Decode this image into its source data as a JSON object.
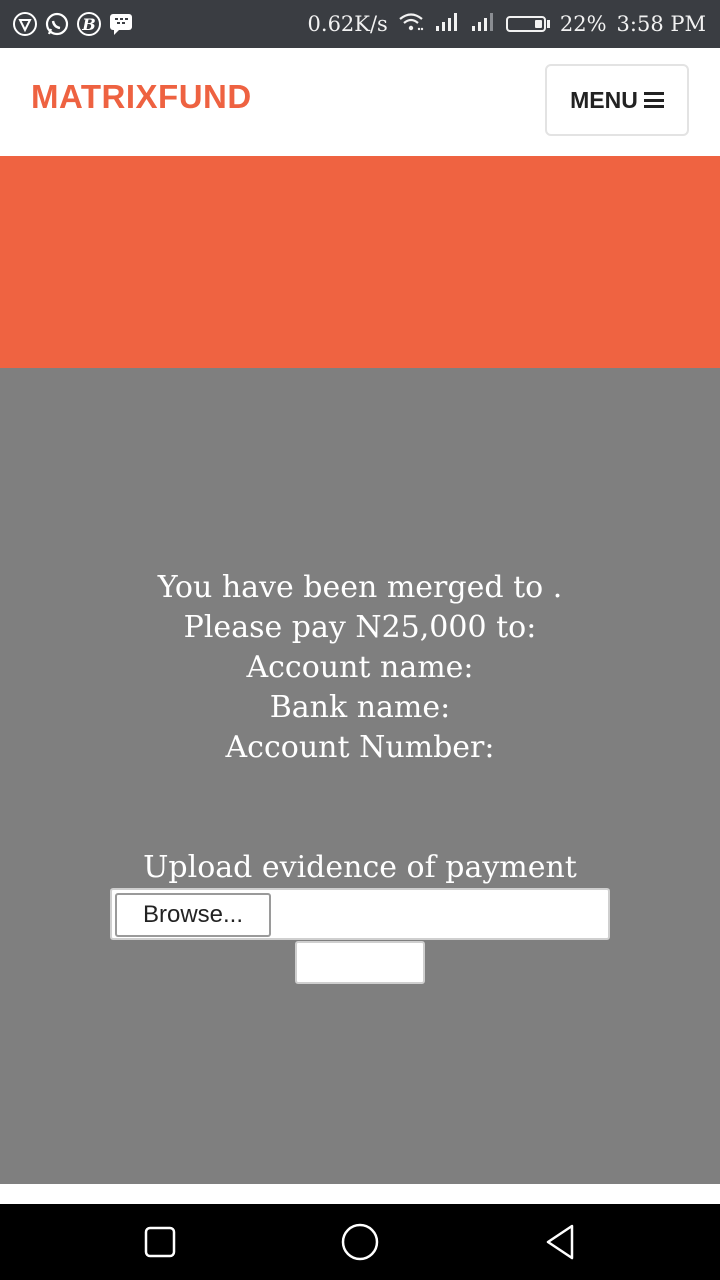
{
  "status_bar": {
    "left_icons": [
      "shield-icon",
      "whatsapp-icon",
      "b-icon",
      "bbm-icon"
    ],
    "net_speed": "0.62K/s",
    "battery_percent": "22%",
    "battery_level": 0.22,
    "time": "3:58 PM"
  },
  "header": {
    "brand": "MATRIXFUND",
    "menu_label": "MENU"
  },
  "colors": {
    "brand": "#ee6241",
    "hero": "#ef6341",
    "content_bg": "#7f7f7f"
  },
  "main": {
    "lines": [
      "You have been merged to .",
      "Please pay N25,000 to:",
      "Account name:",
      "Bank name:",
      "Account Number:"
    ],
    "upload_label": "Upload evidence of payment",
    "browse_label": "Browse...",
    "submit_label": ""
  },
  "nav": {
    "icons": [
      "recents-icon",
      "home-icon",
      "back-icon"
    ]
  }
}
